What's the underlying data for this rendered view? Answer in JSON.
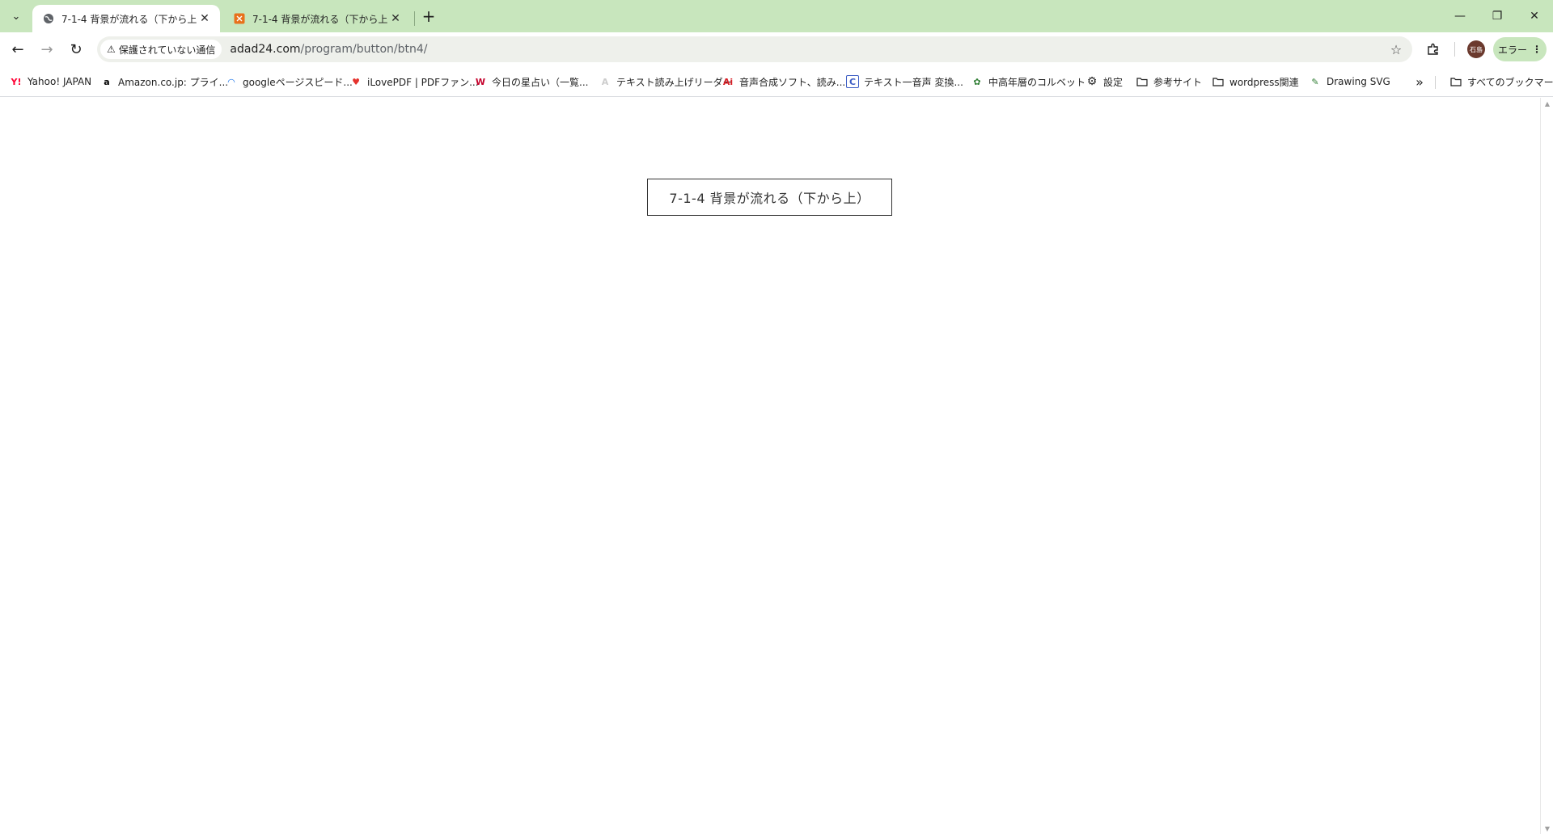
{
  "tabs": [
    {
      "title": "7-1-4 背景が流れる（下から上）",
      "active": true,
      "favicon": "globe-icon"
    },
    {
      "title": "7-1-4 背景が流れる（下から上）",
      "active": false,
      "favicon": "code-icon"
    }
  ],
  "tab_close_glyph": "✕",
  "new_tab_glyph": "+",
  "window": {
    "minimize": "—",
    "restore": "❐",
    "close": "✕"
  },
  "toolbar": {
    "security_label": "保護されていない通信",
    "url_host": "adad24.com",
    "url_path": "/program/button/btn4/",
    "avatar_text": "石島",
    "error_label": "エラー"
  },
  "bookmarks": [
    {
      "label": "Yahoo! JAPAN",
      "icon": "yahoo-icon",
      "glyph": "Y!",
      "color": "#ff0033"
    },
    {
      "label": "Amazon.co.jp: プライ...",
      "icon": "amazon-icon",
      "glyph": "a",
      "color": "#000000"
    },
    {
      "label": "googleページスピード...",
      "icon": "pagespeed-icon",
      "glyph": "◠",
      "color": "#1a73e8"
    },
    {
      "label": "iLovePDF | PDFファン...",
      "icon": "heart-icon",
      "glyph": "♥",
      "color": "#e5322d"
    },
    {
      "label": "今日の星占い（一覧...",
      "icon": "fortune-icon",
      "glyph": "W",
      "color": "#c4002b"
    },
    {
      "label": "テキスト読み上げリーダー",
      "icon": "reader-icon",
      "glyph": "A",
      "color": "#cccccc"
    },
    {
      "label": "音声合成ソフト、読み...",
      "icon": "ai-voice-icon",
      "glyph": "Ai",
      "color": "#d71f26"
    },
    {
      "label": "テキスト一音声 変換...",
      "icon": "c-icon",
      "glyph": "C",
      "color": "#3b5cc4"
    },
    {
      "label": "中高年層のコルベット",
      "icon": "corvette-icon",
      "glyph": "✿",
      "color": "#2e7d32"
    },
    {
      "label": "設定",
      "icon": "gear-icon",
      "glyph": "⚙",
      "color": "#1f1f1f"
    },
    {
      "label": "参考サイト",
      "icon": "folder-icon",
      "glyph": "▭",
      "color": "#1f1f1f"
    },
    {
      "label": "wordpress関連",
      "icon": "folder-icon",
      "glyph": "▭",
      "color": "#1f1f1f"
    },
    {
      "label": "Drawing SVG",
      "icon": "drawing-svg-icon",
      "glyph": "✎",
      "color": "#2e7d32"
    }
  ],
  "bookmarks_more": "»",
  "all_bookmarks_label": "すべてのブックマーク",
  "page": {
    "button_label": "7-1-4 背景が流れる（下から上）"
  }
}
